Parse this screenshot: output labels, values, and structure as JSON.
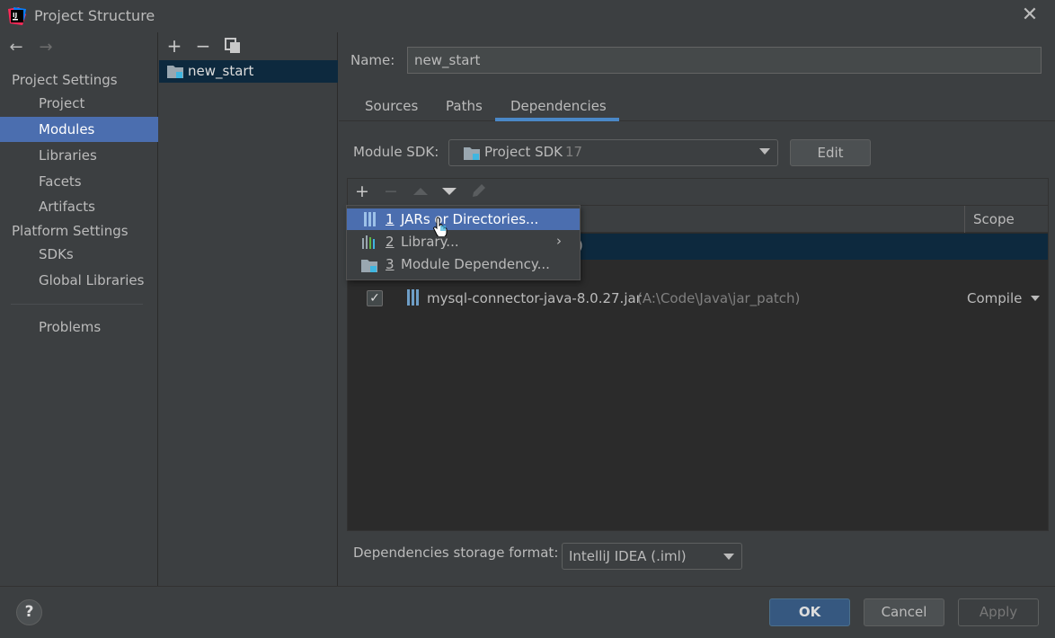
{
  "window": {
    "title": "Project Structure"
  },
  "sidebar": {
    "project_settings_header": "Project Settings",
    "project_settings_items": [
      {
        "label": "Project"
      },
      {
        "label": "Modules",
        "selected": true
      },
      {
        "label": "Libraries"
      },
      {
        "label": "Facets"
      },
      {
        "label": "Artifacts"
      }
    ],
    "platform_settings_header": "Platform Settings",
    "platform_settings_items": [
      {
        "label": "SDKs"
      },
      {
        "label": "Global Libraries"
      }
    ],
    "problems_label": "Problems"
  },
  "modules": {
    "items": [
      {
        "label": "new_start"
      }
    ]
  },
  "main": {
    "name_label": "Name:",
    "name_value": "new_start",
    "tabs": [
      {
        "label": "Sources"
      },
      {
        "label": "Paths"
      },
      {
        "label": "Dependencies",
        "active": true
      }
    ],
    "sdk_label": "Module SDK:",
    "sdk_value": "Project SDK",
    "sdk_version": "17",
    "edit_label": "Edit",
    "table": {
      "scope_header": "Scope",
      "rows": [
        {
          "partial_text": ")",
          "selected": true
        },
        {
          "checked": true,
          "name": "mysql-connector-java-8.0.27.jar",
          "path": "(A:\\Code\\Java\\jar_patch)",
          "scope": "Compile"
        }
      ]
    },
    "popup_menu": [
      {
        "number": "1",
        "label": "JARs or Directories...",
        "icon": "jar-icon",
        "selected": true
      },
      {
        "number": "2",
        "label": "Library...",
        "icon": "library-icon",
        "has_submenu": true
      },
      {
        "number": "3",
        "label": "Module Dependency...",
        "icon": "module-icon"
      }
    ],
    "storage_format_label": "Dependencies storage format:",
    "storage_format_value": "IntelliJ IDEA (.iml)"
  },
  "footer": {
    "help_label": "?",
    "ok_label": "OK",
    "cancel_label": "Cancel",
    "apply_label": "Apply"
  },
  "colors": {
    "background": "#3c3f41",
    "selection": "#4b6eaf",
    "table_bg": "#2b2b2b",
    "row_selection": "#0d293e",
    "accent": "#4a88c7"
  }
}
